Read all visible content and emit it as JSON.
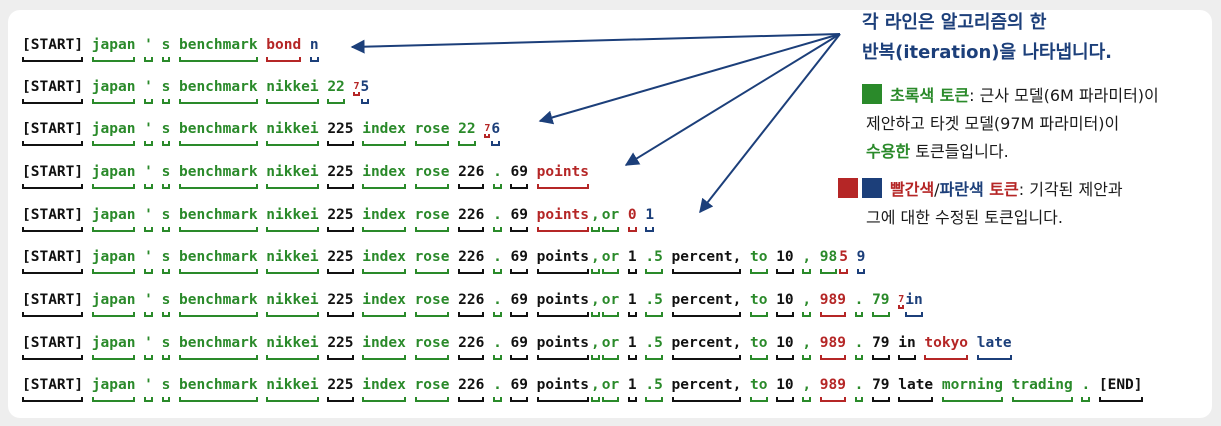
{
  "colors": {
    "black": "#111111",
    "green": "#2a8a2a",
    "red": "#b52626",
    "blue": "#1c3f7a"
  },
  "lines": [
    [
      [
        "[START]",
        "black"
      ],
      [
        "japan",
        "green"
      ],
      [
        "'",
        "green"
      ],
      [
        "s",
        "green"
      ],
      [
        "benchmark",
        "green"
      ],
      [
        "bond",
        "red"
      ],
      [
        "n",
        "blue"
      ]
    ],
    [
      [
        "[START]",
        "black"
      ],
      [
        "japan",
        "green"
      ],
      [
        "'",
        "green"
      ],
      [
        "s",
        "green"
      ],
      [
        "benchmark",
        "green"
      ],
      [
        "nikkei",
        "green"
      ],
      [
        "22",
        "green"
      ],
      [
        "7",
        "red",
        "sub"
      ],
      [
        "5",
        "blue"
      ]
    ],
    [
      [
        "[START]",
        "black"
      ],
      [
        "japan",
        "green"
      ],
      [
        "'",
        "green"
      ],
      [
        "s",
        "green"
      ],
      [
        "benchmark",
        "green"
      ],
      [
        "nikkei",
        "green"
      ],
      [
        "225",
        "black"
      ],
      [
        "index",
        "green"
      ],
      [
        "rose",
        "green"
      ],
      [
        "22",
        "green"
      ],
      [
        "7",
        "red",
        "sub"
      ],
      [
        "6",
        "blue"
      ]
    ],
    [
      [
        "[START]",
        "black"
      ],
      [
        "japan",
        "green"
      ],
      [
        "'",
        "green"
      ],
      [
        "s",
        "green"
      ],
      [
        "benchmark",
        "green"
      ],
      [
        "nikkei",
        "green"
      ],
      [
        "225",
        "black"
      ],
      [
        "index",
        "green"
      ],
      [
        "rose",
        "green"
      ],
      [
        "226",
        "black"
      ],
      [
        ".",
        "green"
      ],
      [
        "69",
        "black"
      ],
      [
        "points",
        "red"
      ]
    ],
    [
      [
        "[START]",
        "black"
      ],
      [
        "japan",
        "green"
      ],
      [
        "'",
        "green"
      ],
      [
        "s",
        "green"
      ],
      [
        "benchmark",
        "green"
      ],
      [
        "nikkei",
        "green"
      ],
      [
        "225",
        "black"
      ],
      [
        "index",
        "green"
      ],
      [
        "rose",
        "green"
      ],
      [
        "226",
        "black"
      ],
      [
        ".",
        "green"
      ],
      [
        "69",
        "black"
      ],
      [
        "points",
        "red",
        "tight"
      ],
      [
        ",",
        "green",
        "tight"
      ],
      [
        "or",
        "green"
      ],
      [
        "0",
        "red"
      ],
      [
        "1",
        "blue"
      ]
    ],
    [
      [
        "[START]",
        "black"
      ],
      [
        "japan",
        "green"
      ],
      [
        "'",
        "green"
      ],
      [
        "s",
        "green"
      ],
      [
        "benchmark",
        "green"
      ],
      [
        "nikkei",
        "green"
      ],
      [
        "225",
        "black"
      ],
      [
        "index",
        "green"
      ],
      [
        "rose",
        "green"
      ],
      [
        "226",
        "black"
      ],
      [
        ".",
        "green"
      ],
      [
        "69",
        "black"
      ],
      [
        "points",
        "black",
        "tight"
      ],
      [
        ",",
        "green",
        "tight"
      ],
      [
        "or",
        "green"
      ],
      [
        "1",
        "black"
      ],
      [
        ".5",
        "green"
      ],
      [
        "percent,",
        "black"
      ],
      [
        "to",
        "green"
      ],
      [
        "10",
        "black"
      ],
      [
        ",",
        "green"
      ],
      [
        "98",
        "green",
        "tight"
      ],
      [
        "5",
        "red"
      ],
      [
        "9",
        "blue"
      ]
    ],
    [
      [
        "[START]",
        "black"
      ],
      [
        "japan",
        "green"
      ],
      [
        "'",
        "green"
      ],
      [
        "s",
        "green"
      ],
      [
        "benchmark",
        "green"
      ],
      [
        "nikkei",
        "green"
      ],
      [
        "225",
        "black"
      ],
      [
        "index",
        "green"
      ],
      [
        "rose",
        "green"
      ],
      [
        "226",
        "black"
      ],
      [
        ".",
        "green"
      ],
      [
        "69",
        "black"
      ],
      [
        "points",
        "black",
        "tight"
      ],
      [
        ",",
        "green",
        "tight"
      ],
      [
        "or",
        "green"
      ],
      [
        "1",
        "black"
      ],
      [
        ".5",
        "green"
      ],
      [
        "percent,",
        "black"
      ],
      [
        "to",
        "green"
      ],
      [
        "10",
        "black"
      ],
      [
        ",",
        "green"
      ],
      [
        "989",
        "red"
      ],
      [
        ".",
        "green"
      ],
      [
        "79",
        "green"
      ],
      [
        "7",
        "red",
        "sub"
      ],
      [
        "in",
        "blue"
      ]
    ],
    [
      [
        "[START]",
        "black"
      ],
      [
        "japan",
        "green"
      ],
      [
        "'",
        "green"
      ],
      [
        "s",
        "green"
      ],
      [
        "benchmark",
        "green"
      ],
      [
        "nikkei",
        "green"
      ],
      [
        "225",
        "black"
      ],
      [
        "index",
        "green"
      ],
      [
        "rose",
        "green"
      ],
      [
        "226",
        "black"
      ],
      [
        ".",
        "green"
      ],
      [
        "69",
        "black"
      ],
      [
        "points",
        "black",
        "tight"
      ],
      [
        ",",
        "green",
        "tight"
      ],
      [
        "or",
        "green"
      ],
      [
        "1",
        "black"
      ],
      [
        ".5",
        "green"
      ],
      [
        "percent,",
        "black"
      ],
      [
        "to",
        "green"
      ],
      [
        "10",
        "black"
      ],
      [
        ",",
        "green"
      ],
      [
        "989",
        "red"
      ],
      [
        ".",
        "green"
      ],
      [
        "79",
        "black"
      ],
      [
        "in",
        "black"
      ],
      [
        "tokyo",
        "red"
      ],
      [
        "late",
        "blue"
      ]
    ],
    [
      [
        "[START]",
        "black"
      ],
      [
        "japan",
        "green"
      ],
      [
        "'",
        "green"
      ],
      [
        "s",
        "green"
      ],
      [
        "benchmark",
        "green"
      ],
      [
        "nikkei",
        "green"
      ],
      [
        "225",
        "black"
      ],
      [
        "index",
        "green"
      ],
      [
        "rose",
        "green"
      ],
      [
        "226",
        "black"
      ],
      [
        ".",
        "green"
      ],
      [
        "69",
        "black"
      ],
      [
        "points",
        "black",
        "tight"
      ],
      [
        ",",
        "green",
        "tight"
      ],
      [
        "or",
        "green"
      ],
      [
        "1",
        "black"
      ],
      [
        ".5",
        "green"
      ],
      [
        "percent,",
        "black"
      ],
      [
        "to",
        "green"
      ],
      [
        "10",
        "black"
      ],
      [
        ",",
        "green"
      ],
      [
        "989",
        "red"
      ],
      [
        ".",
        "green"
      ],
      [
        "79",
        "black"
      ],
      [
        "late",
        "black"
      ],
      [
        "morning",
        "green"
      ],
      [
        "trading",
        "green"
      ],
      [
        ".",
        "green"
      ],
      [
        "[END]",
        "black"
      ]
    ]
  ],
  "annotation": {
    "title_line1": "각 라인은 알고리즘의 한",
    "title_line2": "반복(iteration)을 나타냅니다.",
    "green_label": "초록색 토큰",
    "green_desc1": ": 근사 모델(6M 파라미터)이",
    "green_desc2": "제안하고 타겟 모델(97M 파라미터)이",
    "green_accept": "수용한",
    "green_desc3": " 토큰들입니다.",
    "red_label": "빨간색",
    "slash": "/",
    "blue_label": "파란색",
    "token_word": " 토큰",
    "red_desc1": ": 기각된 제안과",
    "red_desc2": "그에 대한 수정된 토큰입니다."
  }
}
